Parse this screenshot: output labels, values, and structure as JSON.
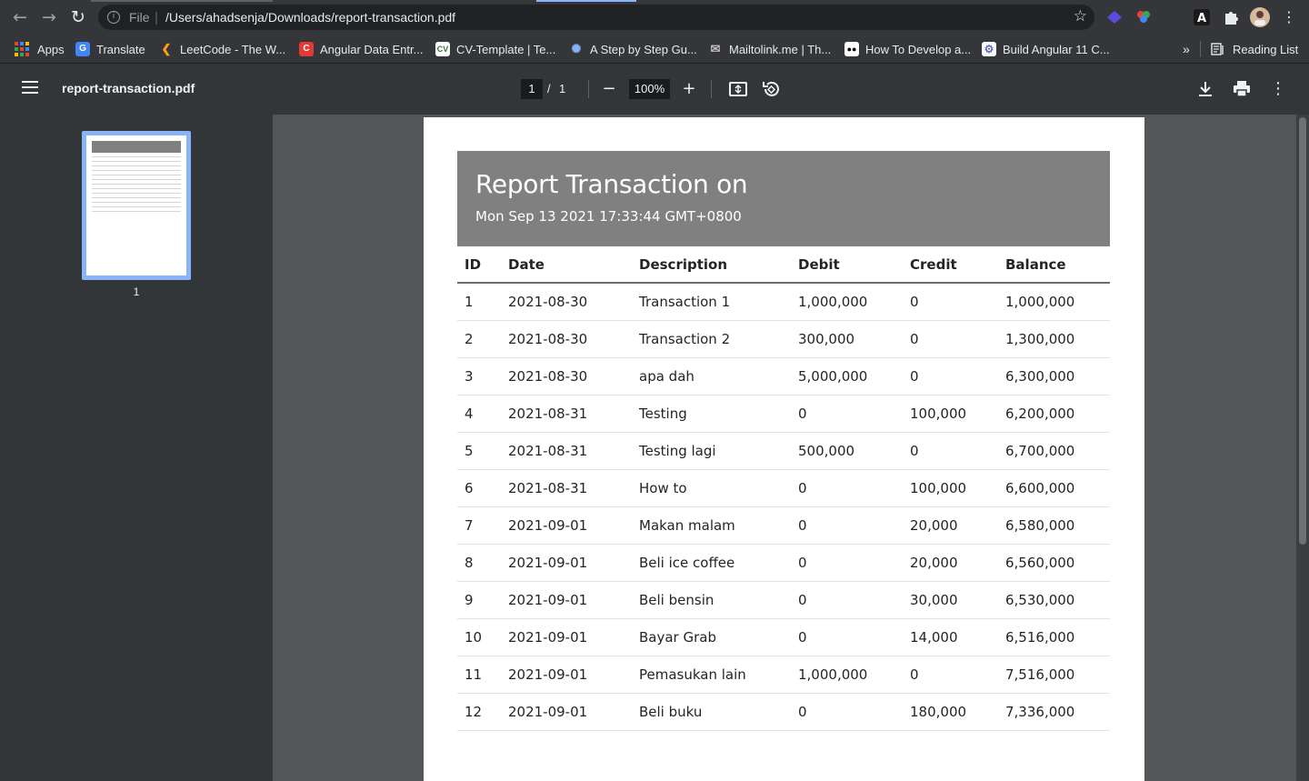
{
  "browser": {
    "scheme": "File",
    "url": "/Users/ahadsenja/Downloads/report-transaction.pdf"
  },
  "bookmarks": {
    "apps": "Apps",
    "items": [
      {
        "label": "Translate",
        "icon": "translate-icon",
        "color": "#4285f4"
      },
      {
        "label": "LeetCode - The W...",
        "icon": "leetcode-icon",
        "color": "#ffa116"
      },
      {
        "label": "Angular Data Entr...",
        "icon": "codecanyon-icon",
        "color": "#e53935"
      },
      {
        "label": "CV-Template | Te...",
        "icon": "cv-icon",
        "color": "#2e7d32"
      },
      {
        "label": "A Step by Step Gu...",
        "icon": "globe-icon",
        "color": "#1565c0"
      },
      {
        "label": "Mailtolink.me | Th...",
        "icon": "mail-icon",
        "color": "#9e9e9e"
      },
      {
        "label": "How To Develop a...",
        "icon": "medium-icon",
        "color": "#000000"
      },
      {
        "label": "Build Angular 11 C...",
        "icon": "settings-icon",
        "color": "#5c6bc0"
      }
    ],
    "overflow": "»",
    "reading_list": "Reading List"
  },
  "pdf_toolbar": {
    "title": "report-transaction.pdf",
    "page_current": "1",
    "page_sep": "/",
    "page_total": "1",
    "zoom": "100%"
  },
  "sidebar": {
    "thumbnail_label": "1"
  },
  "report": {
    "title": "Report Transaction on",
    "subtitle": "Mon Sep 13 2021 17:33:44 GMT+0800",
    "header_color": "#808080",
    "columns": [
      "ID",
      "Date",
      "Description",
      "Debit",
      "Credit",
      "Balance"
    ],
    "rows": [
      [
        "1",
        "2021-08-30",
        "Transaction 1",
        "1,000,000",
        "0",
        "1,000,000"
      ],
      [
        "2",
        "2021-08-30",
        "Transaction 2",
        "300,000",
        "0",
        "1,300,000"
      ],
      [
        "3",
        "2021-08-30",
        "apa dah",
        "5,000,000",
        "0",
        "6,300,000"
      ],
      [
        "4",
        "2021-08-31",
        "Testing",
        "0",
        "100,000",
        "6,200,000"
      ],
      [
        "5",
        "2021-08-31",
        "Testing lagi",
        "500,000",
        "0",
        "6,700,000"
      ],
      [
        "6",
        "2021-08-31",
        "How to",
        "0",
        "100,000",
        "6,600,000"
      ],
      [
        "7",
        "2021-09-01",
        "Makan malam",
        "0",
        "20,000",
        "6,580,000"
      ],
      [
        "8",
        "2021-09-01",
        "Beli ice coffee",
        "0",
        "20,000",
        "6,560,000"
      ],
      [
        "9",
        "2021-09-01",
        "Beli bensin",
        "0",
        "30,000",
        "6,530,000"
      ],
      [
        "10",
        "2021-09-01",
        "Bayar Grab",
        "0",
        "14,000",
        "6,516,000"
      ],
      [
        "11",
        "2021-09-01",
        "Pemasukan lain",
        "1,000,000",
        "0",
        "7,516,000"
      ],
      [
        "12",
        "2021-09-01",
        "Beli buku",
        "0",
        "180,000",
        "7,336,000"
      ]
    ]
  }
}
